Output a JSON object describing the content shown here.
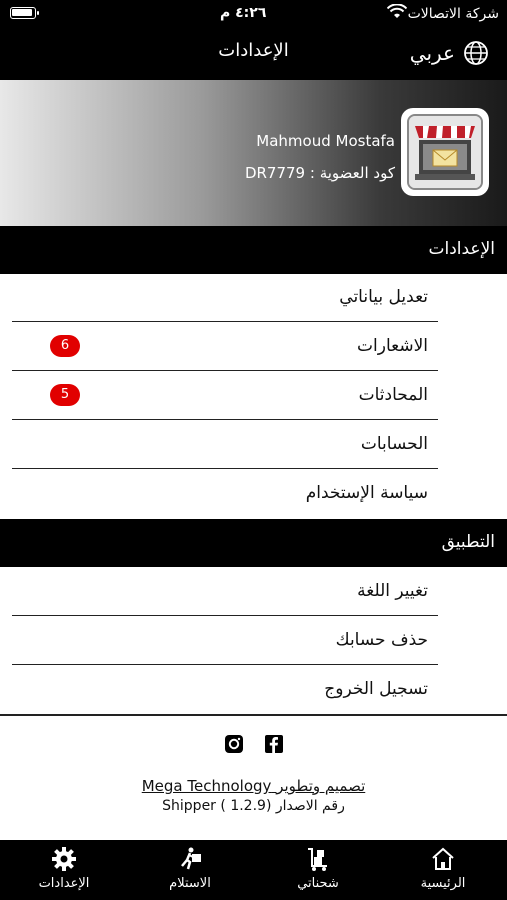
{
  "status_bar": {
    "carrier": "شركة الاتصالات",
    "time": "٤:٢٦ م"
  },
  "header": {
    "title": "الإعدادات",
    "language": "عربي"
  },
  "profile": {
    "name": "Mahmoud Mostafa",
    "member_code": "كود العضوية : DR7779"
  },
  "sections": {
    "settings": {
      "title": "الإعدادات",
      "items": [
        {
          "label": "تعديل بياناتي"
        },
        {
          "label": "الاشعارات",
          "badge": "6"
        },
        {
          "label": "المحادثات",
          "badge": "5"
        },
        {
          "label": "الحسابات"
        },
        {
          "label": "سياسة الإستخدام"
        }
      ]
    },
    "app": {
      "title": "التطبيق",
      "items": [
        {
          "label": "تغيير اللغة"
        },
        {
          "label": "حذف حسابك"
        },
        {
          "label": "تسجيل الخروج"
        }
      ]
    }
  },
  "footer": {
    "credit": "تصميم وتطوير Mega Technology",
    "version": "رقم الاصدار (1.2.9 ) Shipper",
    "social_icons": [
      "instagram-icon",
      "facebook-icon"
    ]
  },
  "tabbar": {
    "tabs": [
      {
        "label": "الرئيسية",
        "icon": "home-icon"
      },
      {
        "label": "شحناتي",
        "icon": "boxes-cart-icon"
      },
      {
        "label": "الاستلام",
        "icon": "delivery-person-icon"
      },
      {
        "label": "الإعدادات",
        "icon": "gear-icon"
      }
    ]
  },
  "colors": {
    "badge": "#e10000",
    "bars": "#000000"
  }
}
